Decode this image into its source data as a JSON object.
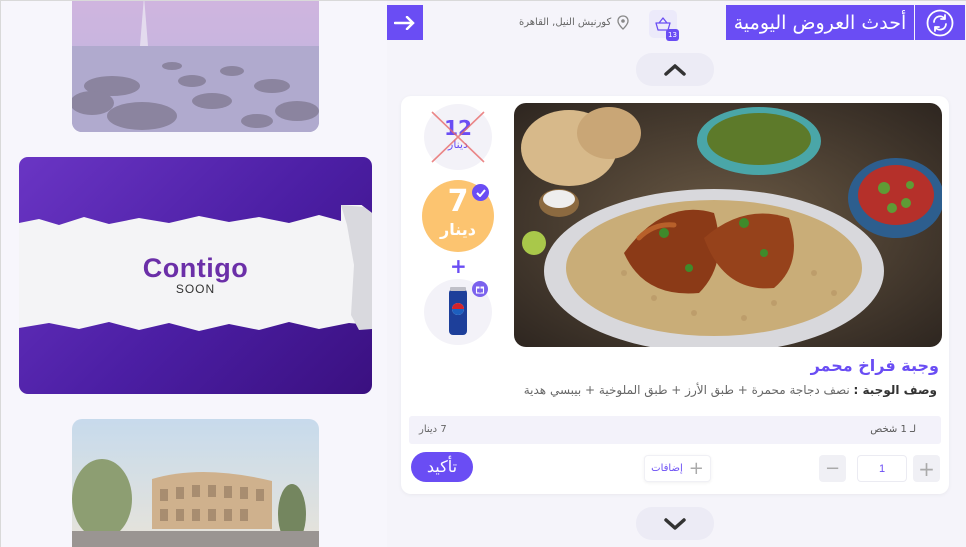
{
  "header": {
    "title": "أحدث العروض اليومية",
    "location": "كورنيش النيل, القاهرة",
    "cart_count": "13",
    "accent_color": "#6a4df4"
  },
  "carousel": {
    "brand_name": "Contigo",
    "brand_sub": "SOON",
    "images": [
      "lake-rocks-sunset",
      "brand-banner",
      "colosseum-rome"
    ]
  },
  "meal": {
    "name": "وجبة فراخ محمر",
    "desc_label": "وصف الوجبة :",
    "desc_text": "نصف دجاجة محمرة + طبق الأرز + طبق الملوخية + بيبسي هدية",
    "old_price": "12",
    "old_currency": "دينار",
    "new_price": "7",
    "new_currency": "دينار",
    "plus": "+",
    "gift": "pepsi-can"
  },
  "pricing": {
    "per_person": "لـ 1 شخص",
    "total": "7 دينار"
  },
  "actions": {
    "confirm": "تأكيد",
    "addons": "إضافات",
    "quantity": "1"
  }
}
